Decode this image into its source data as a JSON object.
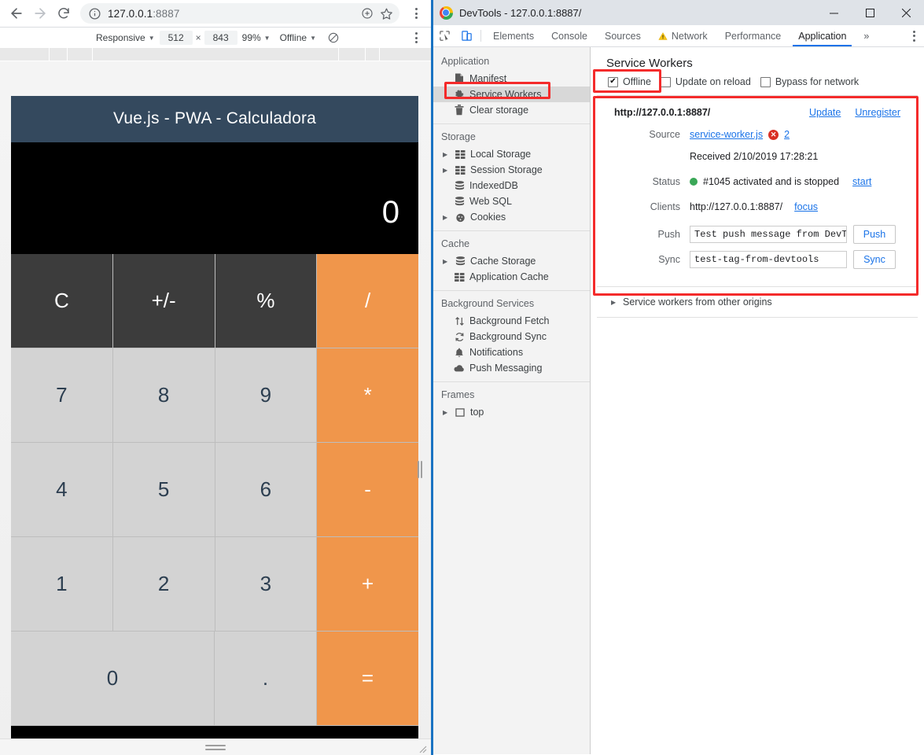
{
  "browser": {
    "nav": {
      "back": "back-arrow",
      "forward": "forward-arrow",
      "reload": "reload"
    },
    "omnibox": {
      "info_icon": "info-circle-icon",
      "url_host": "127.0.0.1",
      "url_port": ":8887",
      "add_icon": "add-to-circle-icon",
      "star_icon": "star-icon"
    },
    "menu_icon": "kebab-menu-icon",
    "device_toolbar": {
      "device": "Responsive",
      "width": "512",
      "times": "×",
      "height": "843",
      "zoom": "99%",
      "throttle": "Offline",
      "rotate_icon": "no-throttle-icon",
      "menu_icon": "kebab-menu-icon"
    }
  },
  "calculator": {
    "title": "Vue.js - PWA - Calculadora",
    "display": "0",
    "rows": [
      [
        {
          "label": "C",
          "kind": "dark"
        },
        {
          "label": "+/-",
          "kind": "dark"
        },
        {
          "label": "%",
          "kind": "dark"
        },
        {
          "label": "/",
          "kind": "op"
        }
      ],
      [
        {
          "label": "7",
          "kind": "num"
        },
        {
          "label": "8",
          "kind": "num"
        },
        {
          "label": "9",
          "kind": "num"
        },
        {
          "label": "*",
          "kind": "op"
        }
      ],
      [
        {
          "label": "4",
          "kind": "num"
        },
        {
          "label": "5",
          "kind": "num"
        },
        {
          "label": "6",
          "kind": "num"
        },
        {
          "label": "-",
          "kind": "op"
        }
      ],
      [
        {
          "label": "1",
          "kind": "num"
        },
        {
          "label": "2",
          "kind": "num"
        },
        {
          "label": "3",
          "kind": "num"
        },
        {
          "label": "+",
          "kind": "op"
        }
      ],
      [
        {
          "label": "0",
          "kind": "num wide"
        },
        {
          "label": ".",
          "kind": "num"
        },
        {
          "label": "=",
          "kind": "op"
        }
      ]
    ],
    "colors": {
      "header": "#34495e",
      "display_bg": "#000000",
      "operator": "#f0964b",
      "number": "#d3d3d3",
      "function": "#3c3c3c"
    }
  },
  "devtools": {
    "window_title": "DevTools - 127.0.0.1:8887/",
    "window_controls": {
      "minimize": "–",
      "maximize": "□",
      "close": "✕"
    },
    "toolbar_icons": {
      "inspect": "inspect-element-icon",
      "device": "device-toolbar-icon"
    },
    "tabs": [
      {
        "label": "Elements",
        "selected": false,
        "warning": false
      },
      {
        "label": "Console",
        "selected": false,
        "warning": false
      },
      {
        "label": "Sources",
        "selected": false,
        "warning": false
      },
      {
        "label": "Network",
        "selected": false,
        "warning": true
      },
      {
        "label": "Performance",
        "selected": false,
        "warning": false
      },
      {
        "label": "Application",
        "selected": true,
        "warning": false
      }
    ],
    "more_tabs": "»",
    "menu_icon": "kebab-menu-icon",
    "sidebar": {
      "groups": [
        {
          "title": "Application",
          "items": [
            {
              "label": "Manifest",
              "icon": "manifest-file-icon",
              "arrow": false,
              "selected": false
            },
            {
              "label": "Service Workers",
              "icon": "gear-icon",
              "arrow": false,
              "selected": true
            },
            {
              "label": "Clear storage",
              "icon": "trash-icon",
              "arrow": false,
              "selected": false
            }
          ]
        },
        {
          "title": "Storage",
          "items": [
            {
              "label": "Local Storage",
              "icon": "table-grid-icon",
              "arrow": true,
              "selected": false
            },
            {
              "label": "Session Storage",
              "icon": "table-grid-icon",
              "arrow": true,
              "selected": false
            },
            {
              "label": "IndexedDB",
              "icon": "database-icon",
              "arrow": false,
              "selected": false
            },
            {
              "label": "Web SQL",
              "icon": "database-icon",
              "arrow": false,
              "selected": false
            },
            {
              "label": "Cookies",
              "icon": "cookie-icon",
              "arrow": true,
              "selected": false
            }
          ]
        },
        {
          "title": "Cache",
          "items": [
            {
              "label": "Cache Storage",
              "icon": "database-icon",
              "arrow": true,
              "selected": false
            },
            {
              "label": "Application Cache",
              "icon": "table-grid-icon",
              "arrow": false,
              "selected": false
            }
          ]
        },
        {
          "title": "Background Services",
          "items": [
            {
              "label": "Background Fetch",
              "icon": "up-down-arrows-icon",
              "arrow": false,
              "selected": false
            },
            {
              "label": "Background Sync",
              "icon": "sync-icon",
              "arrow": false,
              "selected": false
            },
            {
              "label": "Notifications",
              "icon": "bell-icon",
              "arrow": false,
              "selected": false
            },
            {
              "label": "Push Messaging",
              "icon": "cloud-icon",
              "arrow": false,
              "selected": false
            }
          ]
        },
        {
          "title": "Frames",
          "items": [
            {
              "label": "top",
              "icon": "frame-icon",
              "arrow": true,
              "selected": false
            }
          ]
        }
      ]
    },
    "service_workers": {
      "panel_title": "Service Workers",
      "options": [
        {
          "label": "Offline",
          "checked": true
        },
        {
          "label": "Update on reload",
          "checked": false
        },
        {
          "label": "Bypass for network",
          "checked": false
        }
      ],
      "registration": {
        "origin": "http://127.0.0.1:8887/",
        "update_link": "Update",
        "unregister_link": "Unregister",
        "source_label": "Source",
        "source_file": "service-worker.js",
        "error_count": "2",
        "received": "Received 2/10/2019 17:28:21",
        "status_label": "Status",
        "status_text": "#1045 activated and is stopped",
        "status_action": "start",
        "clients_label": "Clients",
        "clients_value": "http://127.0.0.1:8887/",
        "clients_action": "focus",
        "push_label": "Push",
        "push_value": "Test push message from DevToc",
        "push_button": "Push",
        "sync_label": "Sync",
        "sync_value": "test-tag-from-devtools",
        "sync_button": "Sync"
      },
      "other_origins": "Service workers from other origins"
    },
    "annotation_color": "#f42b2b"
  }
}
